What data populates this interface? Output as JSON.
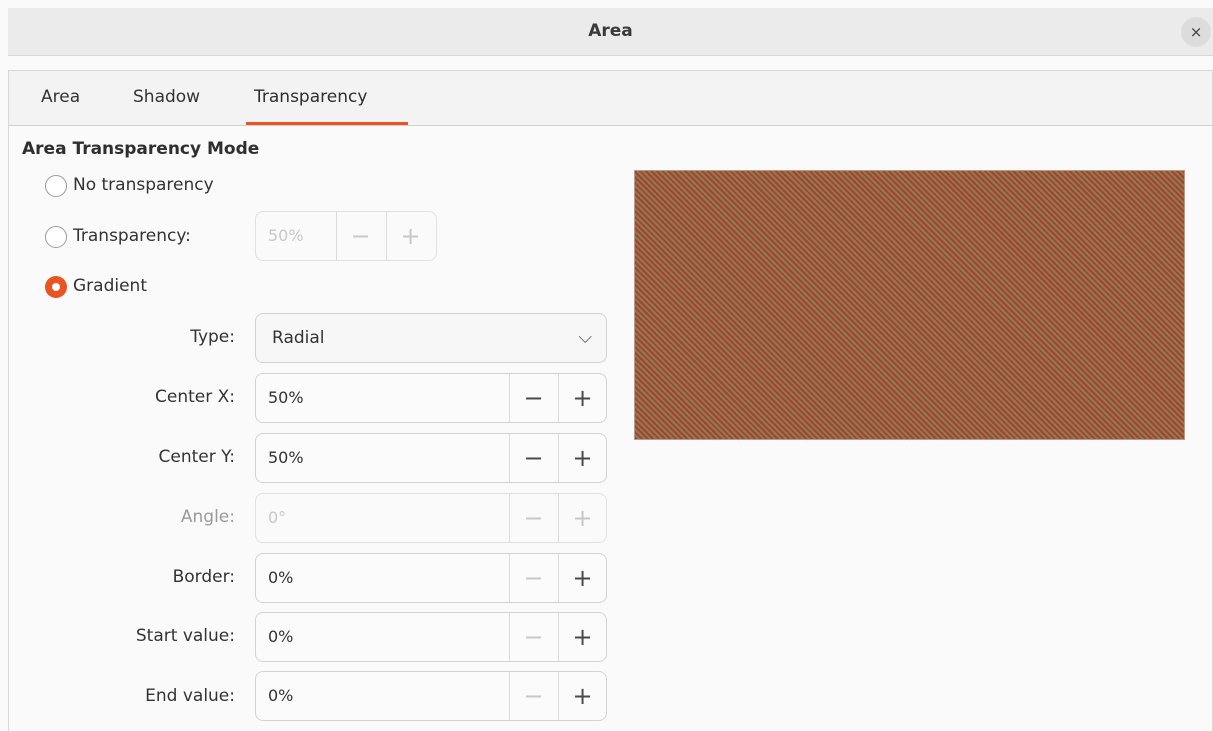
{
  "window": {
    "title": "Area",
    "close_symbol": "×"
  },
  "tabs": [
    {
      "label": "Area"
    },
    {
      "label": "Shadow"
    },
    {
      "label": "Transparency",
      "active": true
    }
  ],
  "section": {
    "title": "Area Transparency Mode"
  },
  "modes": {
    "no_transparency": {
      "label": "No transparency",
      "checked": false
    },
    "transparency": {
      "label": "Transparency:",
      "checked": false,
      "value": "50%"
    },
    "gradient": {
      "label": "Gradient",
      "checked": true
    }
  },
  "gradient": {
    "type": {
      "label": "Type:",
      "value": "Radial"
    },
    "center_x": {
      "label": "Center X:",
      "value": "50%"
    },
    "center_y": {
      "label": "Center Y:",
      "value": "50%"
    },
    "angle": {
      "label": "Angle:",
      "value": "0°",
      "disabled": true
    },
    "border": {
      "label": "Border:",
      "value": "0%"
    },
    "start_value": {
      "label": "Start value:",
      "value": "0%"
    },
    "end_value": {
      "label": "End value:",
      "value": "0%"
    }
  },
  "symbols": {
    "minus": "−",
    "plus": "+",
    "chevron": "⌵"
  },
  "colors": {
    "accent": "#e95420",
    "preview_a": "#a4442a",
    "preview_b": "#8f7a57"
  }
}
